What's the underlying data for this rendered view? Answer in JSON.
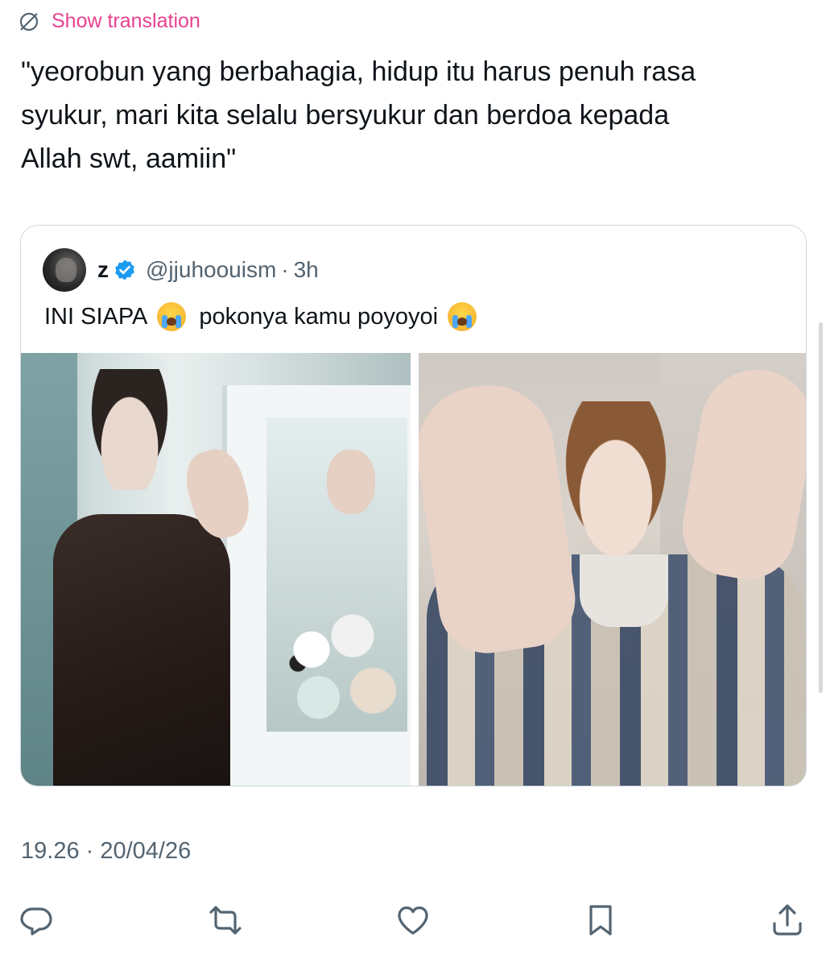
{
  "translate": {
    "label": "Show translation",
    "icon": "globe-slash-icon",
    "color": "#e8418f"
  },
  "tweet": {
    "text": "\"yeorobun yang berbahagia, hidup itu harus penuh rasa\nsyukur, mari kita selalu bersyukur dan berdoa kepada\nAllah swt, aamiin\"",
    "timestamp": "19.26 · 20/04/26"
  },
  "quote": {
    "name": "z",
    "handle": "@jjuhoouism",
    "separator": "·",
    "time": "3h",
    "verified_icon": "verified-badge-icon",
    "text_part1": "INI SIAPA",
    "text_part2": "pokonya kamu poyoyoi",
    "emoji": "loudly-crying-face-emoji",
    "photos": [
      {
        "name": "photo-person-claw-machine"
      },
      {
        "name": "photo-person-plaid-jacket"
      }
    ]
  },
  "actions": {
    "reply_icon": "reply-icon",
    "repost_icon": "repost-icon",
    "like_icon": "like-icon",
    "bookmark_icon": "bookmark-icon",
    "share_icon": "share-icon"
  },
  "colors": {
    "text": "#0f1419",
    "secondary": "#536471",
    "border": "#cfd9de",
    "verified": "#1d9bf0"
  }
}
